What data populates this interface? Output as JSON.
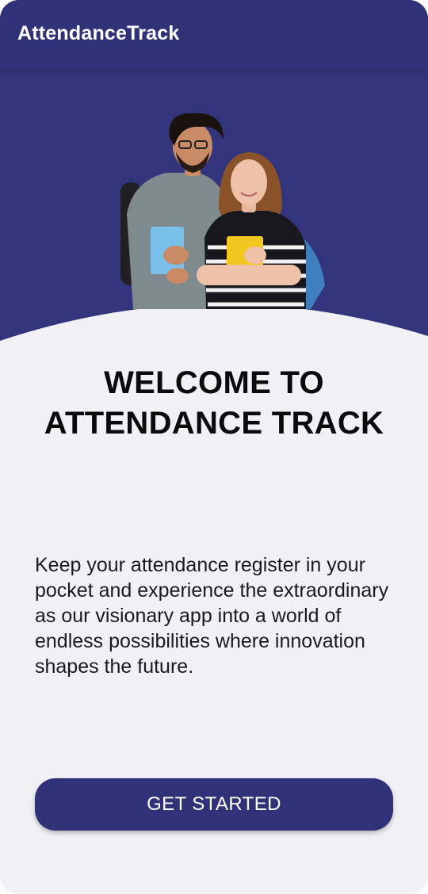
{
  "app": {
    "title": "AttendanceTrack"
  },
  "onboarding": {
    "heading": "WELCOME TO ATTENDANCE TRACK",
    "description": "Keep your attendance register in your pocket and experience the extraordinary as our visionary app into a world of endless possibilities where innovation shapes the future.",
    "cta_label": "GET STARTED"
  },
  "theme": {
    "primary": "#303277",
    "hero_background": "#33357c",
    "page_background": "#f1f0f5",
    "text": "#0b0b0b"
  },
  "hero_image": {
    "subject": "two students holding books and backpacks"
  }
}
